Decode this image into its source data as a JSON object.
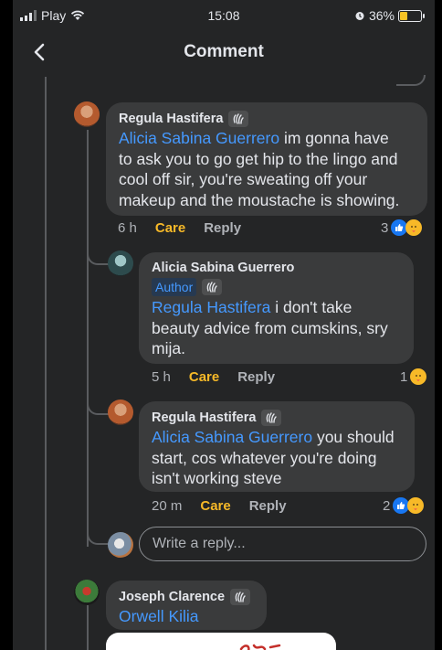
{
  "status": {
    "carrier": "Play",
    "time": "15:08",
    "battery": "36%",
    "battery_level": 0.36
  },
  "header": {
    "title": "Comment"
  },
  "comments": [
    {
      "name": "Regula Hastifera",
      "mention": "Alicia Sabina Guerrero",
      "lines": [
        "im gonna have",
        "to ask you to go get hip to the lingo and",
        "cool off sir, you're sweating off your",
        "makeup and the moustache is showing."
      ],
      "time": "6 h",
      "care": "Care",
      "reply": "Reply",
      "reaction_count": "3"
    },
    {
      "name": "Alicia Sabina Guerrero",
      "badge": "Author",
      "mention": "Regula Hastifera",
      "lines": [
        "i don't take",
        "beauty advice from cumskins, sry",
        "mija."
      ],
      "time": "5 h",
      "care": "Care",
      "reply": "Reply",
      "reaction_count": "1"
    },
    {
      "name": "Regula Hastifera",
      "mention": "Alicia Sabina Guerrero",
      "lines": [
        "you should",
        "start, cos whatever you're doing",
        "isn't working steve"
      ],
      "time": "20 m",
      "care": "Care",
      "reply": "Reply",
      "reaction_count": "2"
    },
    {
      "name": "Joseph Clarence",
      "mention": "Orwell Kilia"
    }
  ],
  "reply_box": {
    "placeholder": "Write a reply..."
  },
  "colors": {
    "mention": "#4599ff",
    "care": "#f7b928",
    "bubble": "#3a3b3c",
    "background": "#242526"
  }
}
